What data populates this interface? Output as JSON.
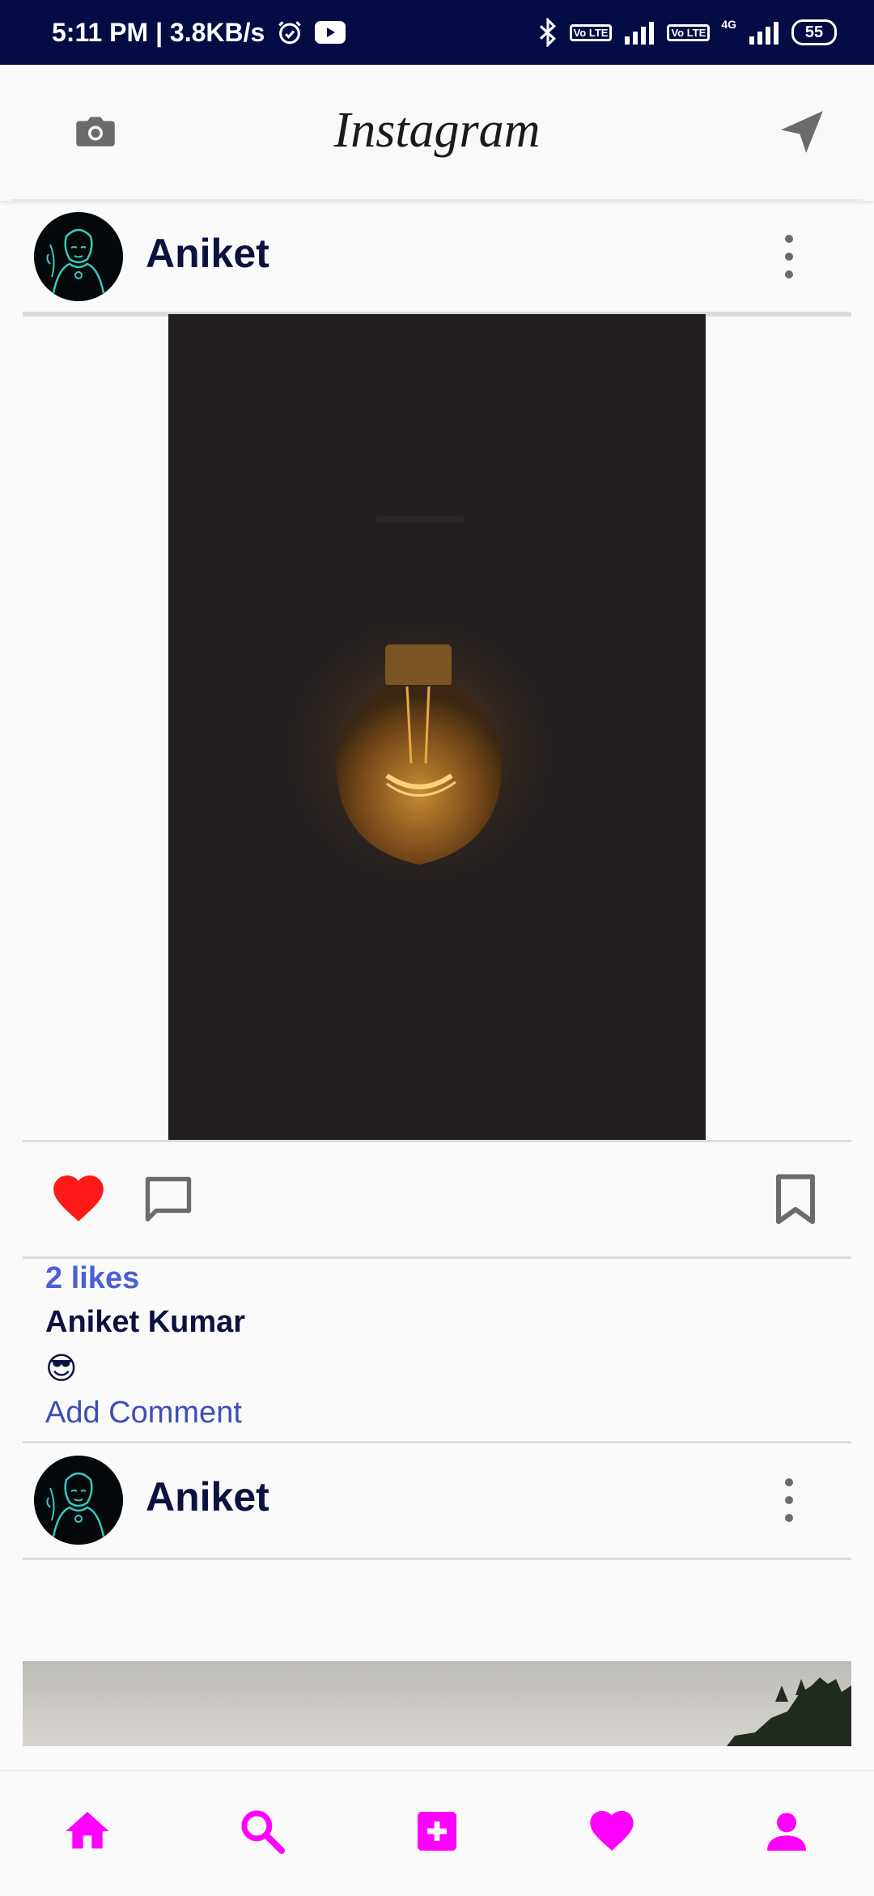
{
  "status_bar": {
    "time_speed": "5:11 PM | 3.8KB/s",
    "lte1": "Vo LTE",
    "lte2": "Vo LTE",
    "net_type": "4G",
    "battery": "55"
  },
  "app_bar": {
    "title": "Instagram",
    "camera_icon": "camera-icon",
    "send_icon": "send-icon"
  },
  "posts": [
    {
      "username": "Aniket",
      "likes": "2 likes",
      "author": "Aniket Kumar",
      "caption": "😎",
      "add_comment": "Add Comment"
    },
    {
      "username": "Aniket"
    }
  ],
  "colors": {
    "status_bar": "#030c45",
    "like": "#ff1a1a",
    "likes_text": "#4b5fd6",
    "nav_accent": "#ff00ff"
  },
  "bottom_nav": [
    "home-icon",
    "search-icon",
    "add-icon",
    "heart-icon",
    "profile-icon"
  ]
}
